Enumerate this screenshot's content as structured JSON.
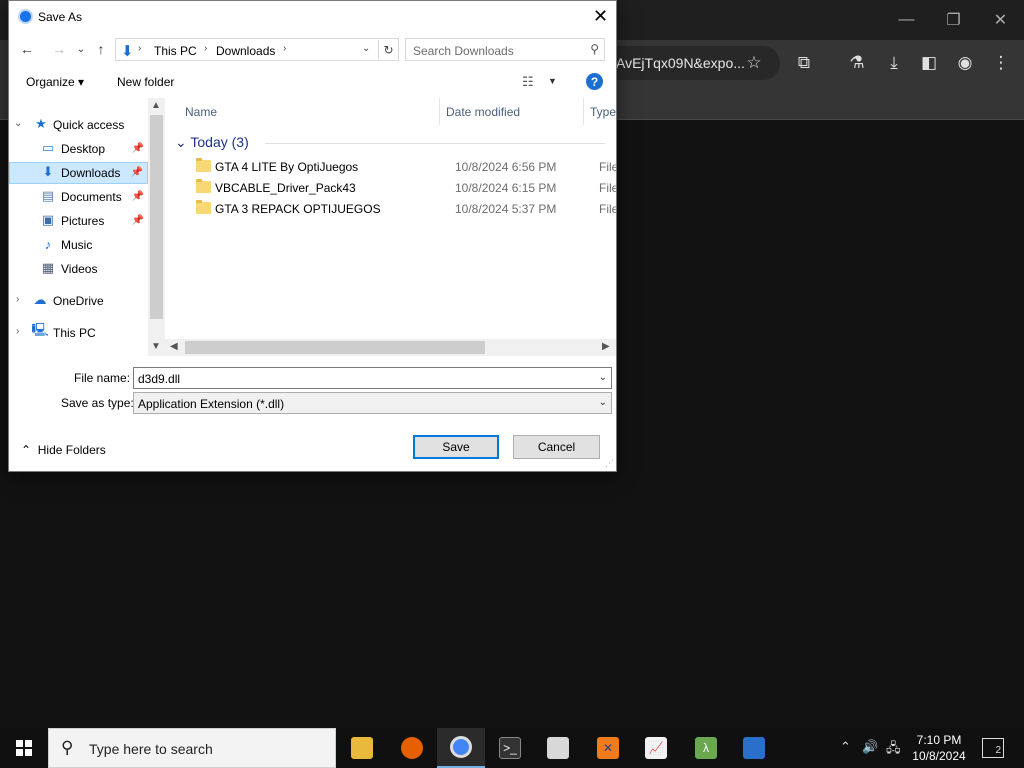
{
  "browser": {
    "url_fragment": "AvEjTqx09N&expo...",
    "controls": {
      "minimize": "—",
      "restore": "❐",
      "close": "✕"
    }
  },
  "dialog": {
    "title": "Save As",
    "close_label": "✕",
    "nav": {
      "back": "←",
      "forward": "→",
      "recent": "⌄",
      "up": "↑",
      "path": [
        "This PC",
        "Downloads"
      ],
      "search_placeholder": "Search Downloads"
    },
    "command_bar": {
      "organize": "Organize ▾",
      "new_folder": "New folder",
      "help": "?"
    },
    "tree": [
      {
        "label": "Quick access",
        "icon": "star-icon",
        "expander": "⌄"
      },
      {
        "label": "Desktop",
        "icon": "desktop-icon",
        "pinned": true
      },
      {
        "label": "Downloads",
        "icon": "download-icon",
        "pinned": true,
        "selected": true
      },
      {
        "label": "Documents",
        "icon": "documents-icon",
        "pinned": true
      },
      {
        "label": "Pictures",
        "icon": "pictures-icon",
        "pinned": true
      },
      {
        "label": "Music",
        "icon": "music-icon"
      },
      {
        "label": "Videos",
        "icon": "videos-icon"
      },
      {
        "label": "OneDrive",
        "icon": "cloud-icon",
        "expander": "›"
      },
      {
        "label": "This PC",
        "icon": "computer-icon",
        "expander": "›"
      }
    ],
    "columns": [
      "Name",
      "Date modified",
      "Type"
    ],
    "group": "Today (3)",
    "files": [
      {
        "name": "GTA 4 LITE By OptiJuegos",
        "date": "10/8/2024 6:56 PM",
        "type": "File fo"
      },
      {
        "name": "VBCABLE_Driver_Pack43",
        "date": "10/8/2024 6:15 PM",
        "type": "File fo"
      },
      {
        "name": "GTA 3 REPACK OPTIJUEGOS",
        "date": "10/8/2024 5:37 PM",
        "type": "File fo"
      }
    ],
    "form": {
      "file_name_label": "File name:",
      "file_name_value": "d3d9.dll",
      "save_type_label": "Save as type:",
      "save_type_value": "Application Extension (*.dll)"
    },
    "hide_folders": "Hide Folders",
    "save_label": "Save",
    "cancel_label": "Cancel"
  },
  "taskbar": {
    "search_placeholder": "Type here to search",
    "time": "7:10 PM",
    "date": "10/8/2024",
    "notification_count": "2",
    "apps": [
      "file-explorer",
      "firefox",
      "chrome",
      "terminal",
      "app-window",
      "xampp",
      "chart-app",
      "lambda-app",
      "remote-desktop"
    ]
  },
  "colors": {
    "accent": "#0078d7",
    "selection": "#cce8ff",
    "folder": "#f8d775",
    "group_header": "#1e3287"
  }
}
